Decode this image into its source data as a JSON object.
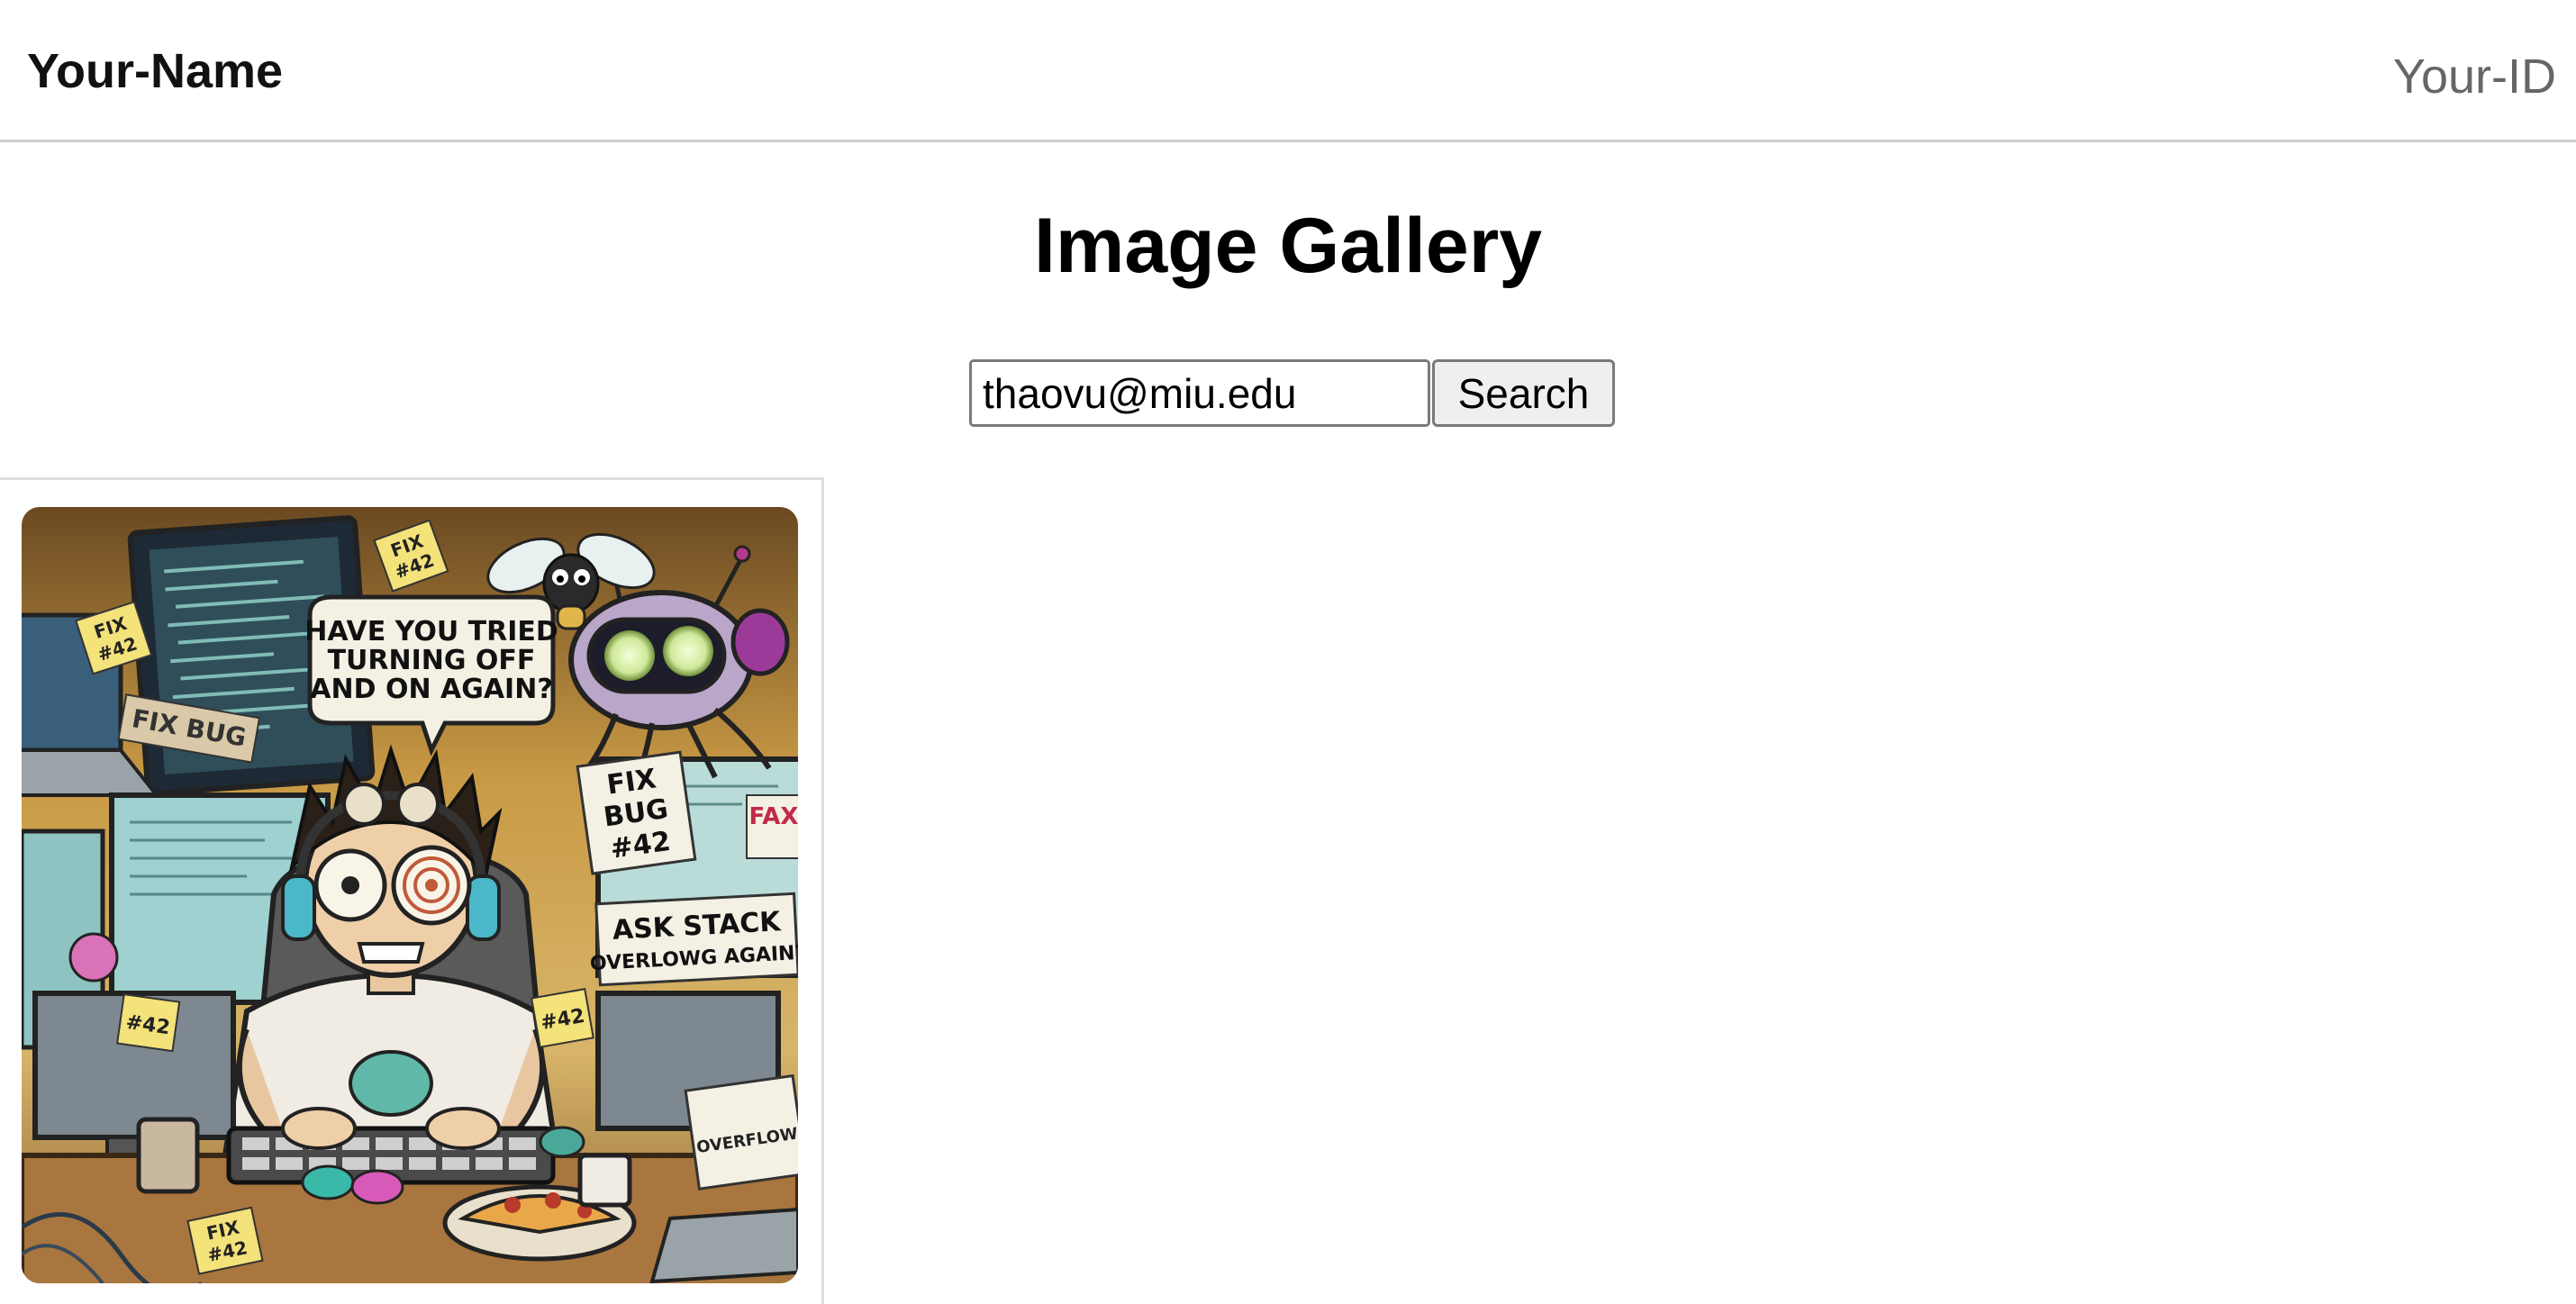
{
  "header": {
    "brand": "Your-Name",
    "user_id": "Your-ID"
  },
  "main": {
    "title": "Image Gallery",
    "search": {
      "value": "thaovu@miu.edu",
      "button_label": "Search"
    }
  },
  "gallery": {
    "items": [
      {
        "speech_bubble": [
          "HAVE YOU TRIED",
          "TURNING OFF",
          "AND ON AGAIN?"
        ],
        "notes": {
          "fix_bug_big": [
            "FIX",
            "BUG",
            "#42"
          ],
          "ask_stack": [
            "ASK STACK",
            "OVERLOWG AGAIN?"
          ],
          "fix42_a": [
            "FIX",
            "#42"
          ],
          "fix42_b": [
            "FIX",
            "#42"
          ],
          "fix_bug_small": "FIX BUG",
          "fax": "FAX",
          "bottom_note": [
            "FIX",
            "#42"
          ],
          "desk_note_1": "#42",
          "desk_note_2": "#42",
          "overflow_note": "OVERFLOW"
        }
      }
    ]
  }
}
